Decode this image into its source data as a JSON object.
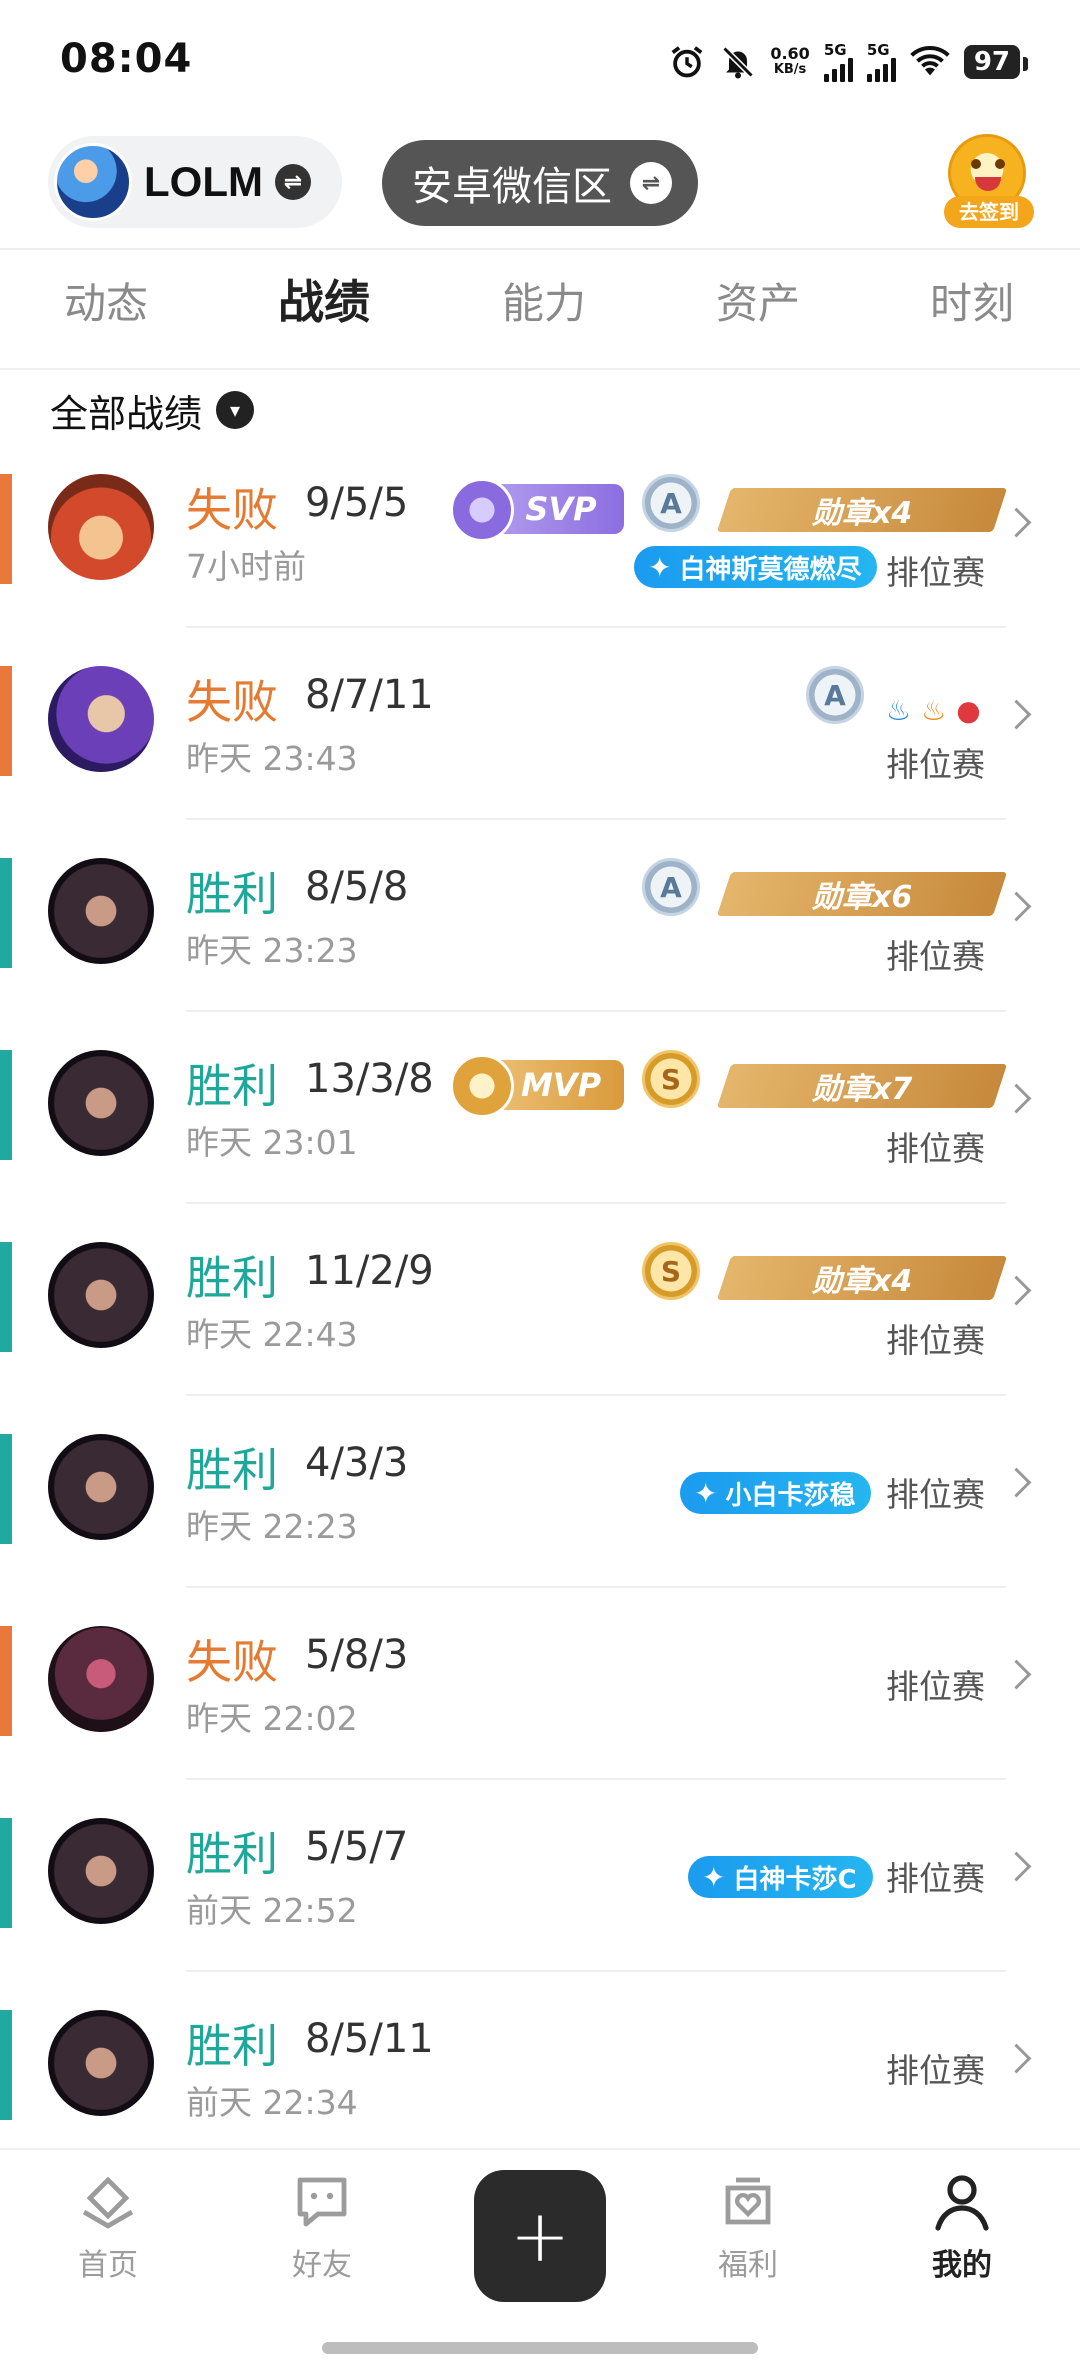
{
  "status_bar": {
    "time": "08:04",
    "net_speed": "0.60",
    "net_unit": "KB/s",
    "sig1": "5G",
    "sig2": "5G",
    "battery": "97"
  },
  "header": {
    "game_name": "LOLM",
    "server_name": "安卓微信区",
    "signin_label": "去签到"
  },
  "tabs": [
    "动态",
    "战绩",
    "能力",
    "资产",
    "时刻"
  ],
  "filter": {
    "label": "全部战绩"
  },
  "matches": [
    {
      "result": "失败",
      "kda": "9/5/5",
      "time": "7小时前",
      "mode": "排位赛",
      "svp": "SVP",
      "grade": "A",
      "medal": "勋章x4",
      "title": "白神斯莫德燃尽"
    },
    {
      "result": "失败",
      "kda": "8/7/11",
      "time": "昨天 23:43",
      "mode": "排位赛",
      "grade": "A"
    },
    {
      "result": "胜利",
      "kda": "8/5/8",
      "time": "昨天 23:23",
      "mode": "排位赛",
      "grade": "A",
      "medal": "勋章x6"
    },
    {
      "result": "胜利",
      "kda": "13/3/8",
      "time": "昨天 23:01",
      "mode": "排位赛",
      "mvp": "MVP",
      "grade": "S",
      "medal": "勋章x7"
    },
    {
      "result": "胜利",
      "kda": "11/2/9",
      "time": "昨天 22:43",
      "mode": "排位赛",
      "grade": "S",
      "medal": "勋章x4"
    },
    {
      "result": "胜利",
      "kda": "4/3/3",
      "time": "昨天 22:23",
      "mode": "排位赛",
      "title": "小白卡莎稳"
    },
    {
      "result": "失败",
      "kda": "5/8/3",
      "time": "昨天 22:02",
      "mode": "排位赛"
    },
    {
      "result": "胜利",
      "kda": "5/5/7",
      "time": "前天 22:52",
      "mode": "排位赛",
      "title": "白神卡莎C"
    },
    {
      "result": "胜利",
      "kda": "8/5/11",
      "time": "前天 22:34",
      "mode": "排位赛"
    }
  ],
  "bottom_nav": [
    "首页",
    "好友",
    "福利",
    "我的"
  ],
  "colors": {
    "loss": "#e67a33",
    "win": "#1fa79a",
    "title_pill": "#1b9bef"
  }
}
